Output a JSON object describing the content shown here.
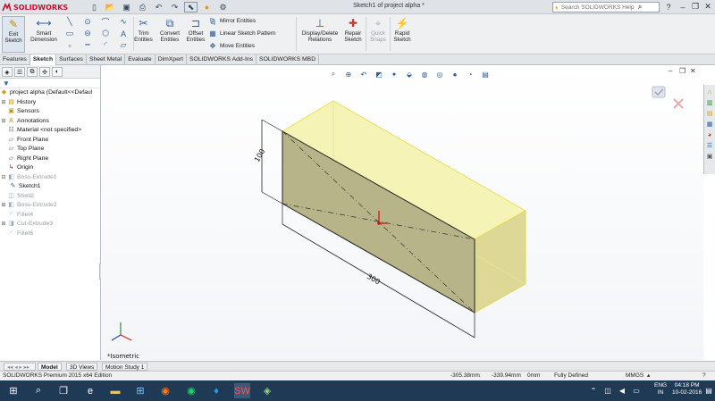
{
  "app": {
    "logo_text": "SOLIDWORKS",
    "window_title": "Sketch1 of project alpha *",
    "help_placeholder": "Search SOLIDWORKS Help"
  },
  "ribbon": {
    "exit_sketch": "Exit Sketch",
    "smart_dimension": "Smart Dimension",
    "trim_entities": "Trim Entities",
    "convert_entities": "Convert Entities",
    "offset_entities": "Offset Entities",
    "mirror_entities": "Mirror Entities",
    "linear_sketch_pattern": "Linear Sketch Pattern",
    "move_entities": "Move Entities",
    "display_delete_relations": "Display/Delete Relations",
    "repair_sketch": "Repair Sketch",
    "quick_snaps": "Quick Snaps",
    "rapid_sketch": "Rapid Sketch"
  },
  "tabs": [
    "Features",
    "Sketch",
    "Surfaces",
    "Sheet Metal",
    "Evaluate",
    "DimXpert",
    "SOLIDWORKS Add-Ins",
    "SOLIDWORKS MBD"
  ],
  "active_tab": "Sketch",
  "tree": {
    "root": "project alpha  (Default<<Defaul",
    "items": [
      "History",
      "Sensors",
      "Annotations",
      "Material <not specified>",
      "Front Plane",
      "Top Plane",
      "Right Plane",
      "Origin",
      "Boss-Extrude1",
      "Sketch1",
      "Shell2",
      "Boss-Extrude2",
      "Fillet4",
      "Cut-Extrude3",
      "Fillet6"
    ]
  },
  "viewport": {
    "dimension_vertical": "100",
    "dimension_horizontal": "300",
    "view_label": "*Isometric"
  },
  "model_tabs": [
    "Model",
    "3D Views",
    "Motion Study 1"
  ],
  "status": {
    "edition": "SOLIDWORKS Premium 2015 x64 Edition",
    "x": "-305.38mm",
    "y": "-339.94mm",
    "z": "0mm",
    "state": "Fully Defined",
    "units": "MMGS"
  },
  "taskbar": {
    "lang1": "ENG",
    "lang2": "IN",
    "time": "04:18 PM",
    "date": "10-02-2016"
  }
}
